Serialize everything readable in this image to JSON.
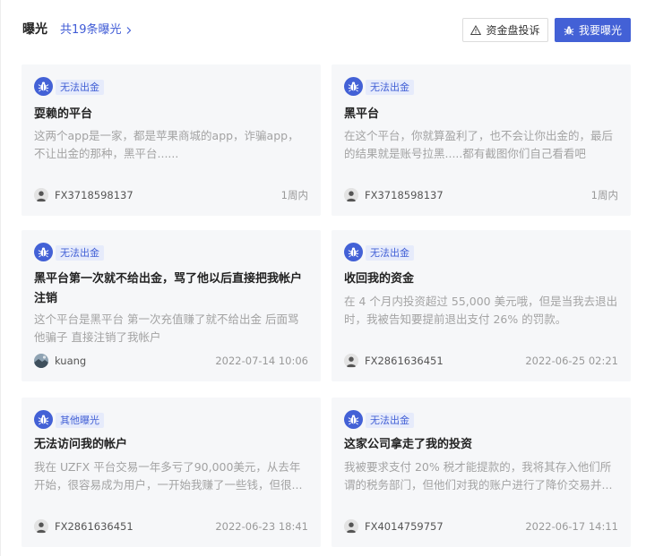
{
  "header": {
    "title": "曝光",
    "count_link": "共19条曝光",
    "complaint_button": "资金盘投诉",
    "expose_button": "我要曝光"
  },
  "colors": {
    "accent": "#4361d6",
    "tag_bg": "#e6ebfb",
    "card_bg": "#f6f7f9",
    "muted_text": "#a3a3a3"
  },
  "cards": [
    {
      "icon": "bug-icon",
      "tag": "无法出金",
      "title": "耍赖的平台",
      "desc": "这两个app是一家，都是苹果商城的app，诈骗app，不让出金的那种，黑平台......",
      "author": "FX3718598137",
      "time": "1周内",
      "avatar": "default-user-avatar"
    },
    {
      "icon": "bug-icon",
      "tag": "无法出金",
      "title": "黑平台",
      "desc": "在这个平台，你就算盈利了，也不会让你出金的，最后的结果就是账号拉黑.....都有截图你们自己看看吧",
      "author": "FX3718598137",
      "time": "1周内",
      "avatar": "default-user-avatar"
    },
    {
      "icon": "bug-icon",
      "tag": "无法出金",
      "title": "黑平台第一次就不给出金，骂了他以后直接把我帐户注销",
      "desc": "这个平台是黑平台 第一次充值赚了就不给出金 后面骂他骗子 直接注销了我帐户",
      "author": "kuang",
      "time": "2022-07-14 10:06",
      "avatar": "photo-avatar"
    },
    {
      "icon": "bug-icon",
      "tag": "无法出金",
      "title": "收回我的资金",
      "desc": "在 4 个月内投资超过 55,000 美元哦，但是当我去退出时，我被告知要提前退出支付 26% 的罚款。",
      "author": "FX2861636451",
      "time": "2022-06-25 02:21",
      "avatar": "default-user-avatar"
    },
    {
      "icon": "bug-icon",
      "tag": "其他曝光",
      "title": "无法访问我的帐户",
      "desc": "我在 UZFX 平台交易一年多亏了90,000美元，从去年开始，很容易成为用户，一开始我赚了一些钱，但很...",
      "author": "FX2861636451",
      "time": "2022-06-23 18:41",
      "avatar": "default-user-avatar"
    },
    {
      "icon": "bug-icon",
      "tag": "无法出金",
      "title": "这家公司拿走了我的投资",
      "desc": "我被要求支付 20% 税才能提款的，我将其存入他们所谓的税务部门，但他们对我的账户进行了降价交易并...",
      "author": "FX4014759757",
      "time": "2022-06-17 14:11",
      "avatar": "default-user-avatar"
    }
  ]
}
